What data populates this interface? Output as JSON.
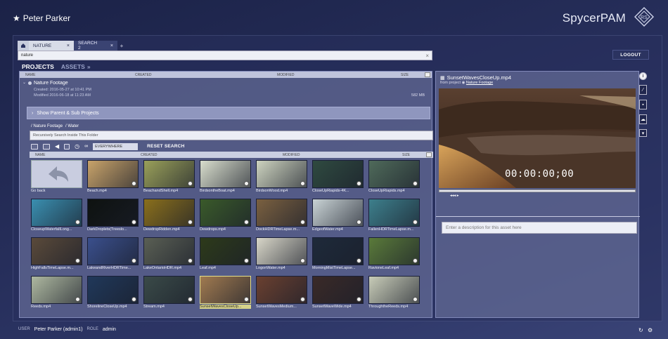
{
  "header": {
    "user_name": "Peter Parker",
    "brand": "SpycerPAM"
  },
  "tabs": [
    {
      "label": "NATURE",
      "active": true,
      "close": "×"
    },
    {
      "label": "SEARCH 2",
      "active": false,
      "close": "×"
    }
  ],
  "tab_add": "+",
  "search": {
    "value": "nature"
  },
  "logout_label": "LOGOUT",
  "nav": {
    "projects": "PROJECTS",
    "assets": "ASSETS"
  },
  "list_columns": {
    "name": "NAME",
    "created": "CREATED",
    "modified": "MODIFIED",
    "size": "SIZE"
  },
  "project": {
    "name": "Nature Footage",
    "created": "Created: 2016-05-27 at 10:41 PM",
    "modified": "Modified 2016-06-18 at 11:23 AM",
    "size": "582 MB"
  },
  "show_parent": "Show Parent & Sub Projects",
  "breadcrumb": [
    "/ Nature Footage",
    "/ Water"
  ],
  "recursive_search": "Recursively Search Inside This Folder",
  "filter_scope": "EVERYWHERE",
  "reset_search": "RESET SEARCH",
  "grid_columns": {
    "name": "NAME",
    "created": "CREATED",
    "modified": "MODIFIED",
    "size": "SIZE"
  },
  "assets": [
    {
      "label": "Go back",
      "icon": "back-arrow-icon"
    },
    {
      "label": "Beach.mp4",
      "color": "#c8a36a"
    },
    {
      "label": "BeachandShell.mp4",
      "color": "#9aa05a"
    },
    {
      "label": "BirdsontheBoat.mp4",
      "color": "#d8ddcc"
    },
    {
      "label": "BirdsonWood.mp4",
      "color": "#cdd3bf"
    },
    {
      "label": "CloseUpRiapids-4K...",
      "color": "#2f4a40"
    },
    {
      "label": "CloseUpRiapids.mp4",
      "color": "#4f6a5a"
    },
    {
      "label": "CloseupWaterfallLong...",
      "color": "#3a8fb0"
    },
    {
      "label": "DarkDroplets(Treeslo...",
      "color": "#0e1210"
    },
    {
      "label": "DewdropRidden.mp4",
      "color": "#8a6f1c"
    },
    {
      "label": "Dewdrops.mp4",
      "color": "#3a5a2a"
    },
    {
      "label": "DockHDRTimeLapse.m...",
      "color": "#7a6040"
    },
    {
      "label": "EdgeofWater.mp4",
      "color": "#c9d3d5"
    },
    {
      "label": "FallenHDRTimeLapse.m...",
      "color": "#3d7f8c"
    },
    {
      "label": "HighFallsTimeLapse.m...",
      "color": "#5a4a3a"
    },
    {
      "label": "LakeandRiverHDRTime...",
      "color": "#3a4f8c"
    },
    {
      "label": "LakeOntarioHDR.mp4",
      "color": "#5a5f54"
    },
    {
      "label": "Leaf.mp4",
      "color": "#2d3a1a"
    },
    {
      "label": "LogonWater.mp4",
      "color": "#d8d6c8"
    },
    {
      "label": "MorningMistTimeLapse...",
      "color": "#1e2a3a"
    },
    {
      "label": "RavioneLeaf.mp4",
      "color": "#5a7a3a"
    },
    {
      "label": "Reeds.mp4",
      "color": "#aeb8a0"
    },
    {
      "label": "ShorelineCloseUp.mp4",
      "color": "#20385a"
    },
    {
      "label": "Stream.mp4",
      "color": "#3a4a48"
    },
    {
      "label": "SunsetWavesCloseUp...",
      "color": "#a07a50",
      "selected": true
    },
    {
      "label": "SunsetWavesMedium...",
      "color": "#6a4030"
    },
    {
      "label": "SunsetWaveWide.mp4",
      "color": "#3a2a28"
    },
    {
      "label": "ThroughtheReeds.mp4",
      "color": "#c8ccb8"
    }
  ],
  "preview": {
    "title": "SunsetWavesCloseUp.mp4",
    "from_label": "from project",
    "project_link": "Nature Footage",
    "timecode": "00:00:00;00",
    "description_placeholder": "Enter a description for this asset here"
  },
  "footer": {
    "user_label": "USER",
    "user_value": "Peter Parker (admin1)",
    "role_label": "ROLE",
    "role_value": "admin"
  }
}
